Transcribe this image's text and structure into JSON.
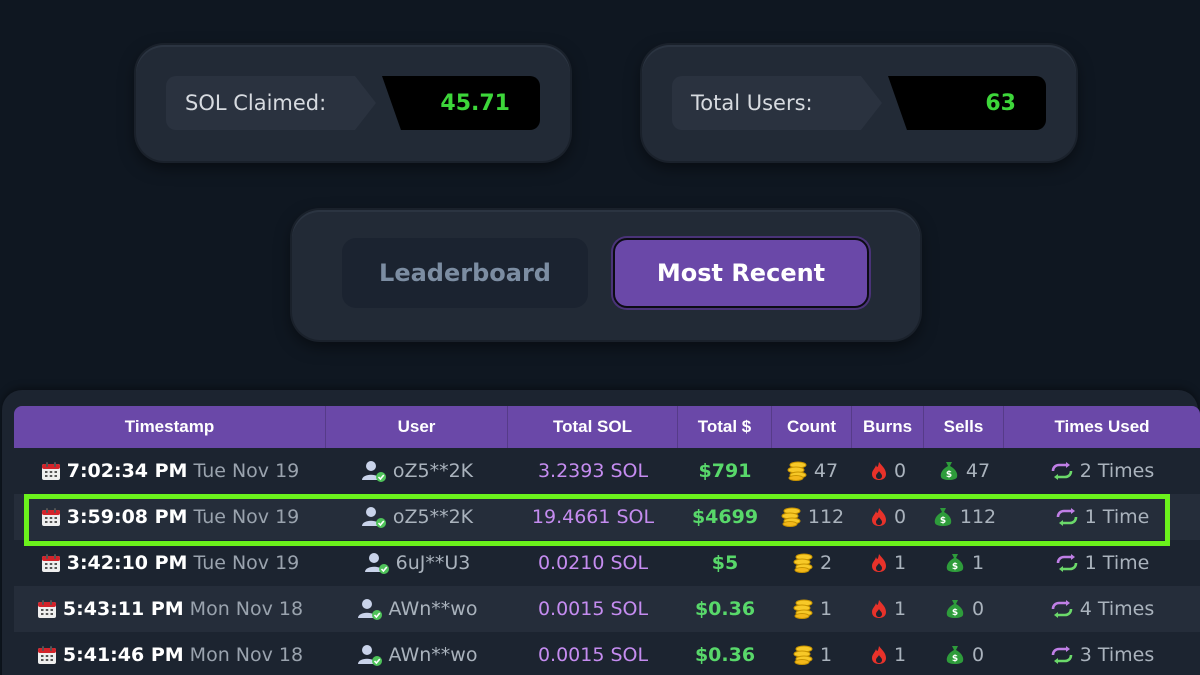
{
  "stats": {
    "sol_claimed": {
      "label": "SOL Claimed:",
      "value": "45.71"
    },
    "total_users": {
      "label": "Total Users:",
      "value": "63"
    }
  },
  "tabs": {
    "leaderboard": "Leaderboard",
    "most_recent": "Most Recent",
    "active": "most_recent"
  },
  "colors": {
    "accent": "#6a48a8",
    "stat_value": "#3dd63a",
    "sol": "#c58cf0",
    "usd": "#58d86a",
    "highlight": "#6bf21c"
  },
  "table": {
    "headers": [
      "Timestamp",
      "User",
      "Total SOL",
      "Total $",
      "Count",
      "Burns",
      "Sells",
      "Times Used"
    ],
    "rows": [
      {
        "time": "7:02:34 PM",
        "date": "Tue Nov 19",
        "user": "oZ5**2K",
        "sol": "3.2393 SOL",
        "usd": "$791",
        "count": "47",
        "burns": "0",
        "sells": "47",
        "used": "2 Times"
      },
      {
        "time": "3:59:08 PM",
        "date": "Tue Nov 19",
        "user": "oZ5**2K",
        "sol": "19.4661 SOL",
        "usd": "$4699",
        "count": "112",
        "burns": "0",
        "sells": "112",
        "used": "1 Time"
      },
      {
        "time": "3:42:10 PM",
        "date": "Tue Nov 19",
        "user": "6uJ**U3",
        "sol": "0.0210 SOL",
        "usd": "$5",
        "count": "2",
        "burns": "1",
        "sells": "1",
        "used": "1 Time"
      },
      {
        "time": "5:43:11 PM",
        "date": "Mon Nov 18",
        "user": "AWn**wo",
        "sol": "0.0015 SOL",
        "usd": "$0.36",
        "count": "1",
        "burns": "1",
        "sells": "0",
        "used": "4 Times"
      },
      {
        "time": "5:41:46 PM",
        "date": "Mon Nov 18",
        "user": "AWn**wo",
        "sol": "0.0015 SOL",
        "usd": "$0.36",
        "count": "1",
        "burns": "1",
        "sells": "0",
        "used": "3 Times"
      }
    ]
  }
}
